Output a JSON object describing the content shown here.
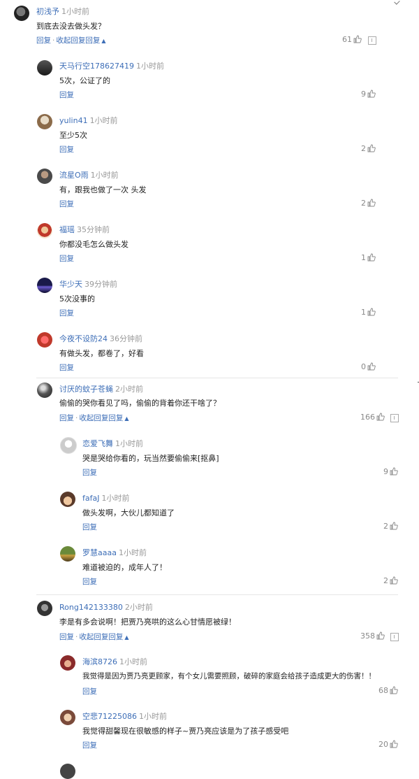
{
  "comments": [
    {
      "name": "初浅予",
      "time": "1小时前",
      "text": "到底去没去做头发？",
      "reply": "回复",
      "collapse": "收起回复",
      "likes": "61"
    },
    {
      "name": "天马行空178627419",
      "time": "1小时前",
      "text": "5次，公证了的",
      "reply": "回复",
      "likes": "9"
    },
    {
      "name": "yulin41",
      "time": "1小时前",
      "text": "至少5次",
      "reply": "回复",
      "likes": "2"
    },
    {
      "name": "流星O雨",
      "time": "1小时前",
      "text": "有，跟我也做了一次 头发",
      "reply": "回复",
      "likes": "2"
    },
    {
      "name": "福瑶",
      "time": "35分钟前",
      "text": "你都没毛怎么做头发",
      "reply": "回复",
      "likes": "1"
    },
    {
      "name": "华少天",
      "time": "39分钟前",
      "text": "5次没事的",
      "reply": "回复",
      "likes": "1"
    },
    {
      "name": "今夜不设防24",
      "time": "36分钟前",
      "text": "有做头发，都卷了，好看",
      "reply": "回复",
      "likes": "0"
    },
    {
      "name": "讨厌的蚊子苍蝇",
      "time": "2小时前",
      "text": "偷偷的哭你看见了吗，偷偷的背着你还干啥了？",
      "reply": "回复",
      "collapse": "收起回复",
      "likes": "166"
    },
    {
      "name": "恋爱飞舞",
      "time": "1小时前",
      "text": "哭是哭给你看的，玩当然要偷偷来[抠鼻]",
      "reply": "回复",
      "likes": "9"
    },
    {
      "name": "fafaJ",
      "time": "1小时前",
      "text": "做头发啊，大伙儿都知道了",
      "reply": "回复",
      "likes": "2"
    },
    {
      "name": "罗慧aaaa",
      "time": "1小时前",
      "text": "难道被迫的，成年人了！",
      "reply": "回复",
      "likes": "2"
    },
    {
      "name": "Rong142133380",
      "time": "2小时前",
      "text": "李是有多会说啊！把贾乃亮哄的这么心甘情愿被绿！",
      "reply": "回复",
      "collapse": "收起回复",
      "likes": "358"
    },
    {
      "name": "海滨8726",
      "time": "1小时前",
      "text": "我觉得是因为贾乃亮更顾家，有个女儿需要照顾，破碎的家庭会给孩子造成更大的伤害！！",
      "reply": "回复",
      "likes": "68"
    },
    {
      "name": "空悲71225086",
      "time": "1小时前",
      "text": "我觉得甜馨现在很敏感的样子~贾乃亮应该是为了孩子感受吧",
      "reply": "回复",
      "likes": "20"
    }
  ],
  "icons": {
    "like": "thumbs-up-icon",
    "report": "report-icon",
    "collapse_caret": "caret-up-icon"
  },
  "colors": {
    "link": "#3d6eb7",
    "meta": "#999999",
    "text": "#222222"
  }
}
